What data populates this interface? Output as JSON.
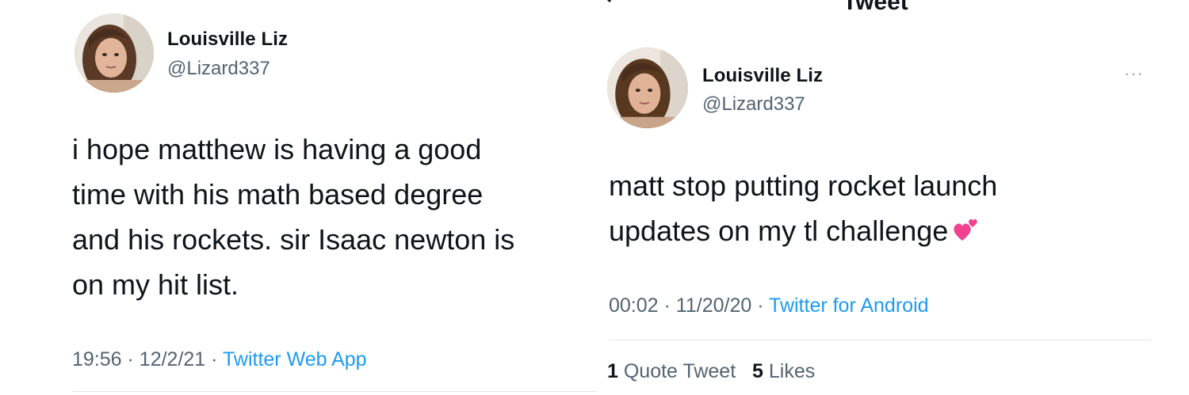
{
  "left_tweet": {
    "display_name": "Louisville Liz",
    "handle": "@Lizard337",
    "text_lines": [
      "i hope matthew is having a good",
      "time with his math based degree",
      "and his rockets. sir Isaac newton is",
      "on my hit list."
    ],
    "time": "19:56",
    "date": "12/2/21",
    "source": "Twitter Web App",
    "separator": "·"
  },
  "right_tweet": {
    "header_title": "Tweet",
    "display_name": "Louisville Liz",
    "handle": "@Lizard337",
    "more_icon": "···",
    "text_lines": [
      "matt stop putting rocket launch",
      "updates on my tl challenge"
    ],
    "emoji": "two-hearts-emoji",
    "time": "00:02",
    "date": "11/20/20",
    "source": "Twitter for Android",
    "separator": "·",
    "quote_tweet_count": "1",
    "quote_tweet_label": "Quote Tweet",
    "likes_count": "5",
    "likes_label": "Likes"
  },
  "colors": {
    "text": "#0f1419",
    "secondary": "#536471",
    "link": "#1d9bf0",
    "divider": "#e1e5e8",
    "emoji": "#f0428f"
  }
}
